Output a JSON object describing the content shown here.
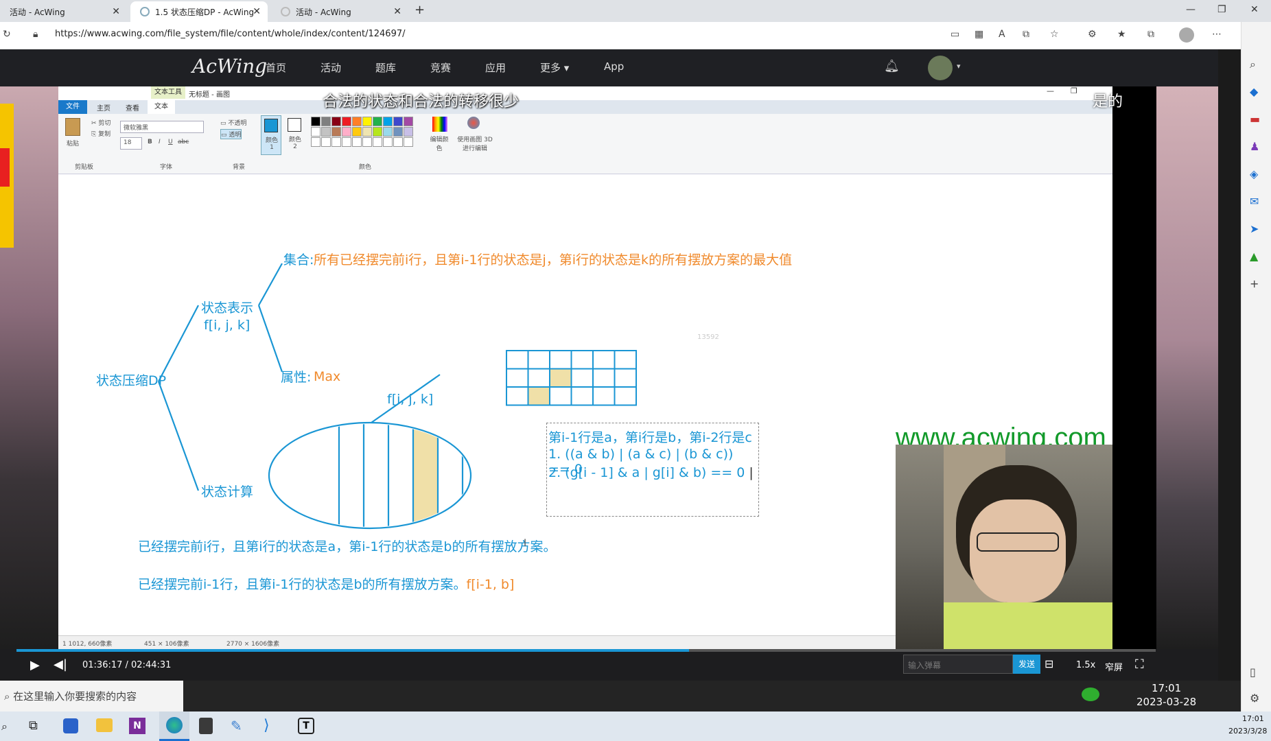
{
  "tabs": [
    {
      "label": "活动 - AcWing"
    },
    {
      "label": "1.5 状态压缩DP - AcWing"
    },
    {
      "label": "活动 - AcWing"
    }
  ],
  "address": {
    "url": "https://www.acwing.com/file_system/file/content/whole/index/content/124697/"
  },
  "site_nav": {
    "logo": "AcWing",
    "items": [
      "首页",
      "活动",
      "题库",
      "竞赛",
      "应用",
      "更多",
      "App"
    ]
  },
  "subtitle": {
    "main": "合法的状态和合法的转移很少",
    "right": "是的"
  },
  "paint": {
    "tool_tab": "文本工具",
    "doc_title": "无标题 - 画图",
    "tabs": [
      "文件",
      "主页",
      "查看",
      "文本"
    ],
    "clipboard": {
      "paste": "粘贴",
      "cut": "剪切",
      "copy": "复制",
      "group": "剪贴板"
    },
    "font": {
      "name": "微软雅黑",
      "size": "18",
      "group": "字体",
      "bold": "B",
      "italic": "I",
      "underline": "U",
      "strike": "abc"
    },
    "background": {
      "opaque": "不透明",
      "transparent": "透明",
      "group": "背景"
    },
    "colors": {
      "color1": "颜色 1",
      "color2": "颜色 2",
      "edit": "编辑颜色",
      "paint3d": "使用画图 3D 进行编辑",
      "group": "颜色"
    },
    "palette": [
      "#000000",
      "#7f7f7f",
      "#880015",
      "#ed1c24",
      "#ff7f27",
      "#fff200",
      "#22b14c",
      "#00a2e8",
      "#3f48cc",
      "#a349a4",
      "#ffffff",
      "#c3c3c3",
      "#b97a57",
      "#ffaec9",
      "#ffc90e",
      "#efe4b0",
      "#b5e61d",
      "#99d9ea",
      "#7092be",
      "#c8bfe7"
    ],
    "statusbar": [
      "1 1012, 660像素",
      "451 × 106像素",
      "2770 × 1606像素"
    ]
  },
  "diagram": {
    "root": "状态压缩DP",
    "state": "状态表示",
    "state_fn": "f[i, j, k]",
    "set_label": "集合:",
    "set_text": "所有已经摆完前i行，且第i-1行的状态是j，第i行的状态是k的所有摆放方案的最大值",
    "attr_label": "属性:",
    "attr_value": "Max",
    "compute": "状态计算",
    "ellipse_label": "f[i, j, k]",
    "cond_title": "第i-1行是a，第i行是b，第i-2行是c",
    "cond1": "1. ((a & b) | (a & c) | (b & c)) == 0",
    "cond2": "2. (g[i - 1] & a | g[i] & b) == 0",
    "line1": "已经摆完前i行，且第i行的状态是a，第i-1行的状态是b的所有摆放方案。",
    "line2": "已经摆完前i-1行，且第i-1行的状态是b的所有摆放方案。",
    "line2_fn": "f[i-1, b]",
    "ghost_num": "13592"
  },
  "watermark": "www.acwing.com",
  "player": {
    "time": "01:36:17 / 02:44:31",
    "danmaku_placeholder": "输入弹幕",
    "send": "发送",
    "speed": "1.5x",
    "wide": "窄屏"
  },
  "inner_taskbar": {
    "search": "在这里输入你要搜索的内容",
    "time": "17:01",
    "date": "2023-03-28"
  },
  "host_taskbar": {
    "time": "17:01",
    "date": "2023/3/28"
  },
  "colors": {
    "accent": "#1a96d4",
    "orange": "#f08a2c",
    "highlight": "#f0e0a8"
  }
}
